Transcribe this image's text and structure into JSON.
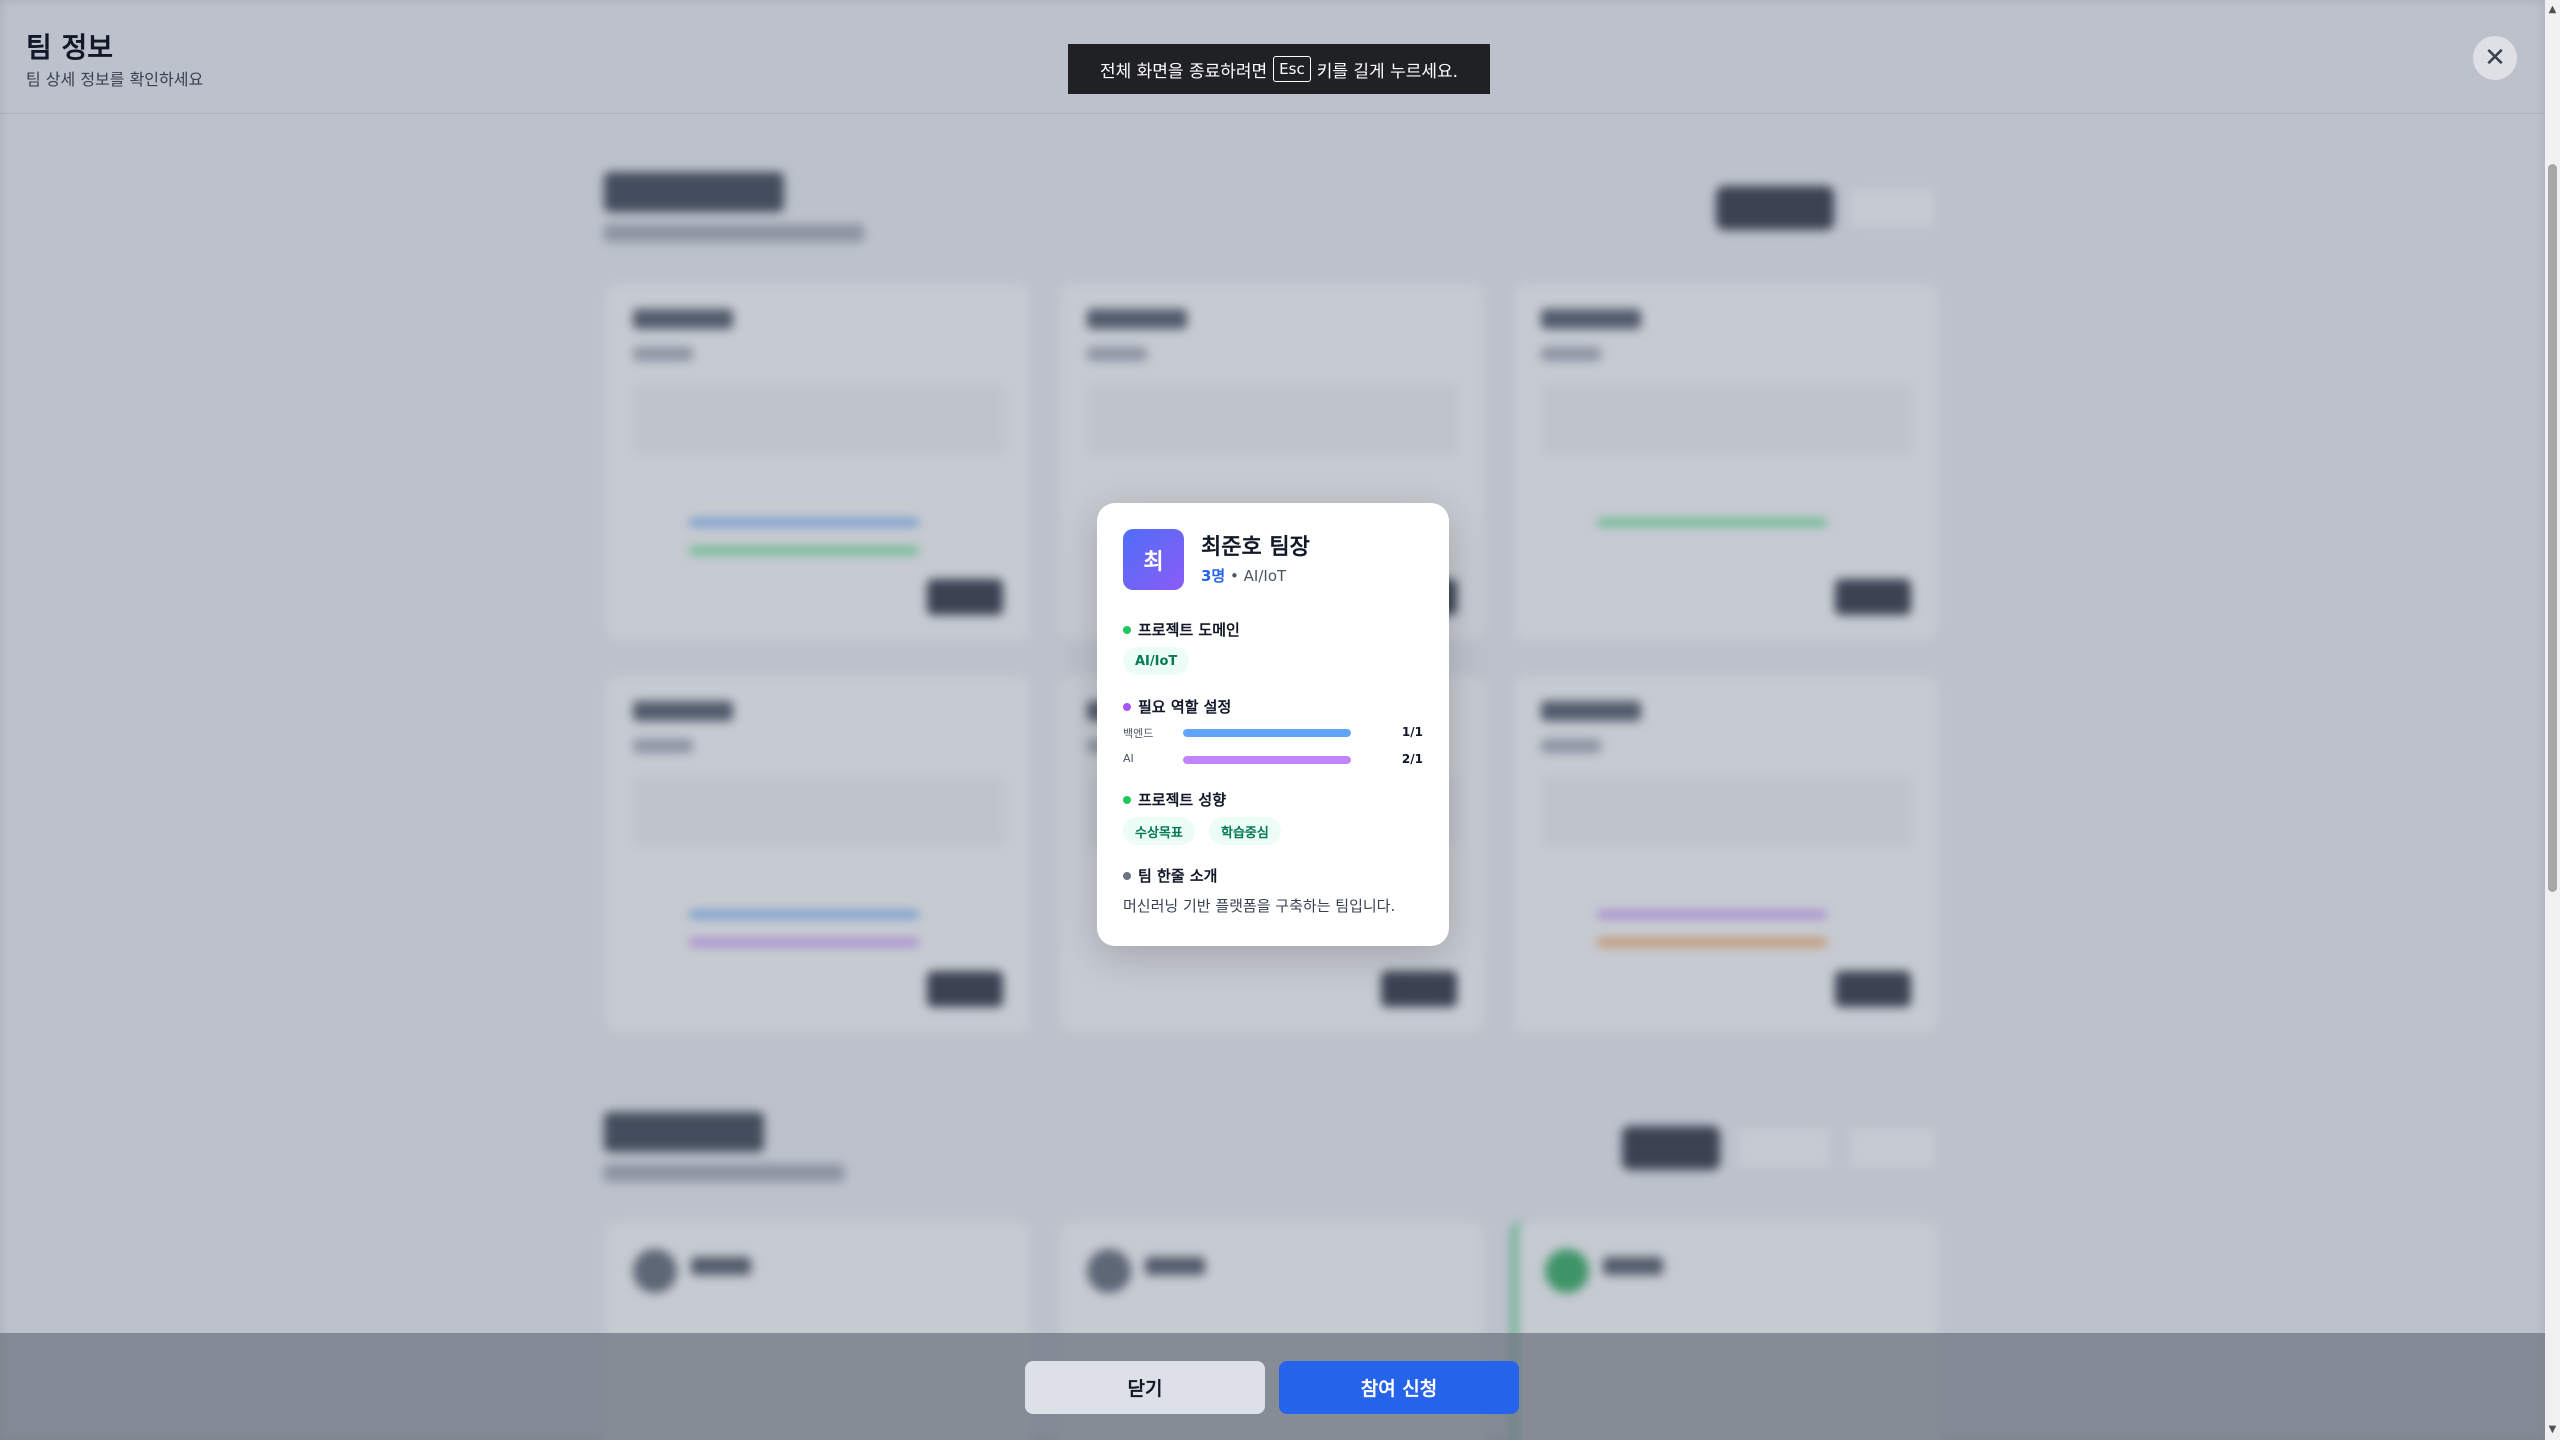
{
  "header": {
    "title": "팀 정보",
    "subtitle": "팀 상세 정보를 확인하세요"
  },
  "fullscreen_toast": {
    "text_before": "전체 화면을 종료하려면",
    "key": "Esc",
    "text_after": "키를 길게 누르세요."
  },
  "modal": {
    "avatar_initial": "최",
    "team_name": "최준호 팀장",
    "member_count": "3명",
    "meta_separator": "•",
    "domain_meta": "AI/IoT",
    "sections": {
      "domain": {
        "title": "프로젝트 도메인",
        "chips": [
          "AI/IoT"
        ],
        "dot_color": "#22c55e"
      },
      "roles": {
        "title": "필요 역할 설정",
        "dot_color": "#a855f7",
        "items": [
          {
            "label": "백엔드",
            "count": "1/1",
            "fill": 1.0,
            "color": "#60a5fa"
          },
          {
            "label": "AI",
            "count": "2/1",
            "fill": 1.0,
            "color": "#c084fc"
          }
        ]
      },
      "tendency": {
        "title": "프로젝트 성향",
        "chips": [
          "수상목표",
          "학습중심"
        ],
        "dot_color": "#22c55e"
      },
      "intro": {
        "title": "팀 한줄 소개",
        "text": "머신러닝 기반 플랫폼을 구축하는 팀입니다.",
        "dot_color": "#6b7280"
      }
    }
  },
  "actions": {
    "close_label": "닫기",
    "join_label": "참여 신청"
  },
  "colors": {
    "primary": "#2563eb",
    "avatar_gradient_start": "#4f6ef7",
    "avatar_gradient_end": "#8b5cf6"
  }
}
